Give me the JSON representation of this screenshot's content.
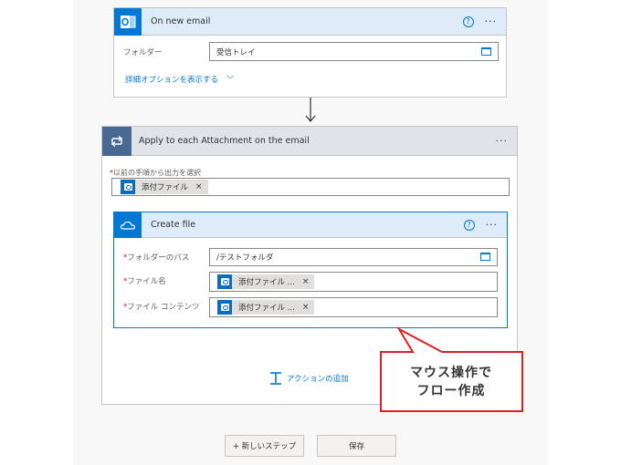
{
  "trigger": {
    "title": "On new email",
    "folder_label": "フォルダー",
    "folder_value": "受信トレイ",
    "advanced_link": "詳細オプションを表示する",
    "accent": "#0078d4"
  },
  "loop": {
    "title": "Apply to each Attachment on the email",
    "select_label": "以前の手順から出力を選択",
    "token": "添付ファイル",
    "token_remove": "×"
  },
  "create_file": {
    "title": "Create file",
    "folder_path_label": "フォルダーのパス",
    "folder_path_value": "/テストフォルダ",
    "file_name_label": "ファイル名",
    "file_name_token": "添付ファイル ...",
    "file_content_label": "ファイル コンテンツ",
    "file_content_token": "添付ファイル ...",
    "token_remove": "×"
  },
  "add_action_link": "アクションの追加",
  "callout": {
    "line1": "マウス操作で",
    "line2": "フロー作成",
    "color": "#e02020"
  },
  "footer": {
    "new_step": "+ 新しいステップ",
    "save": "保存"
  },
  "icons": {
    "help": "?",
    "more": "···"
  }
}
